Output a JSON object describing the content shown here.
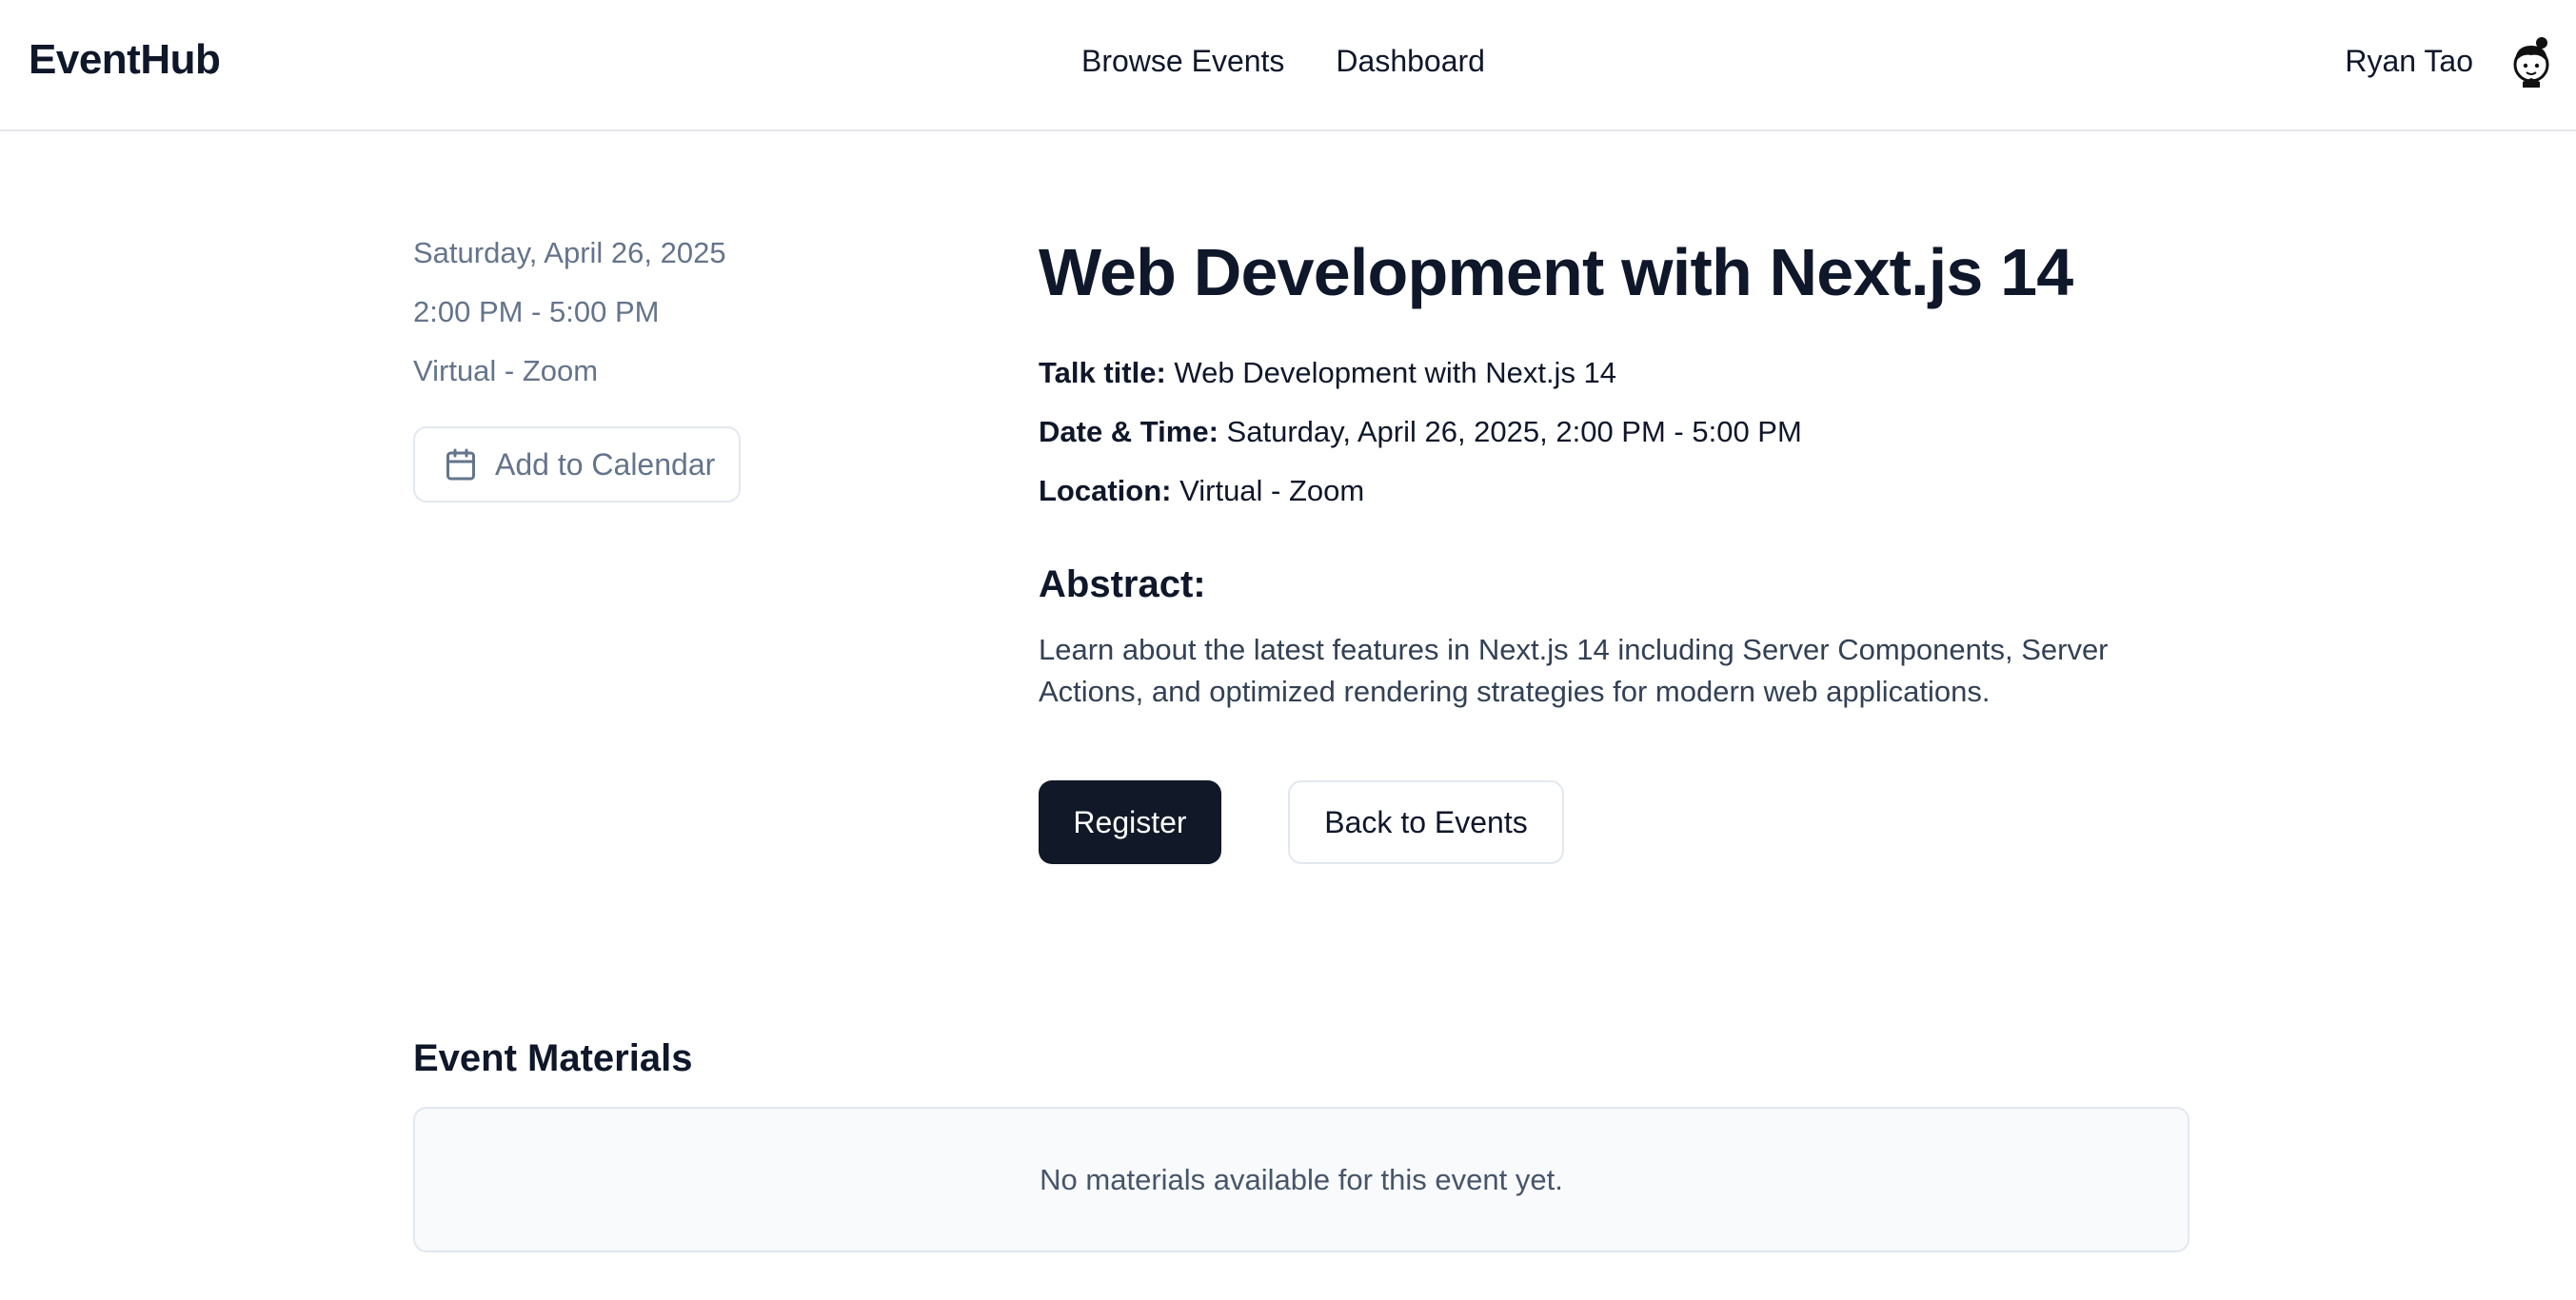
{
  "header": {
    "logo": "EventHub",
    "nav": [
      {
        "label": "Browse Events"
      },
      {
        "label": "Dashboard"
      }
    ],
    "user_name": "Ryan Tao",
    "avatar_icon": "cartoon-avatar-icon"
  },
  "sidebar": {
    "date": "Saturday, April 26, 2025",
    "time": "2:00 PM - 5:00 PM",
    "location": "Virtual - Zoom",
    "calendar_button": "Add to Calendar",
    "calendar_icon": "calendar-icon"
  },
  "event": {
    "title": "Web Development with Next.js 14",
    "talk_title_label": "Talk title:",
    "talk_title_value": "Web Development with Next.js 14",
    "datetime_label": "Date & Time:",
    "datetime_value": "Saturday, April 26, 2025, 2:00 PM - 5:00 PM",
    "location_label": "Location:",
    "location_value": "Virtual - Zoom",
    "abstract_heading": "Abstract:",
    "abstract_text": "Learn about the latest features in Next.js 14 including Server Components, Server Actions, and optimized rendering strategies for modern web applications."
  },
  "actions": {
    "register": "Register",
    "back": "Back to Events"
  },
  "materials": {
    "heading": "Event Materials",
    "empty_text": "No materials available for this event yet."
  },
  "colors": {
    "primary_button": "#111827",
    "muted_text": "#64748b",
    "border": "#e2e8f0",
    "panel_bg": "#f8fafc"
  }
}
